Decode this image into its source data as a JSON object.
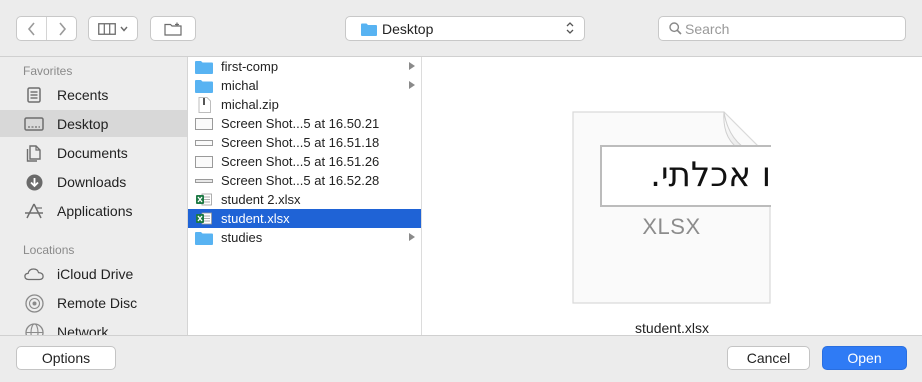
{
  "toolbar": {
    "location": "Desktop",
    "search_placeholder": "Search"
  },
  "sidebar": {
    "favorites_title": "Favorites",
    "favorites": [
      {
        "label": "Recents",
        "icon": "recents-icon"
      },
      {
        "label": "Desktop",
        "icon": "desktop-icon",
        "selected": true
      },
      {
        "label": "Documents",
        "icon": "documents-icon"
      },
      {
        "label": "Downloads",
        "icon": "downloads-icon"
      },
      {
        "label": "Applications",
        "icon": "applications-icon"
      }
    ],
    "locations_title": "Locations",
    "locations": [
      {
        "label": "iCloud Drive",
        "icon": "icloud-icon"
      },
      {
        "label": "Remote Disc",
        "icon": "disc-icon"
      },
      {
        "label": "Network",
        "icon": "network-icon"
      }
    ]
  },
  "files": [
    {
      "name": "first-comp",
      "type": "folder",
      "has_children": true
    },
    {
      "name": "michal",
      "type": "folder",
      "has_children": true
    },
    {
      "name": "michal.zip",
      "type": "zip"
    },
    {
      "name": "Screen Shot...5 at 16.50.21",
      "type": "screenshot"
    },
    {
      "name": "Screen Shot...5 at 16.51.18",
      "type": "screenshot"
    },
    {
      "name": "Screen Shot...5 at 16.51.26",
      "type": "screenshot"
    },
    {
      "name": "Screen Shot...5 at 16.52.28",
      "type": "screenshot"
    },
    {
      "name": "student 2.xlsx",
      "type": "xlsx"
    },
    {
      "name": "student.xlsx",
      "type": "xlsx",
      "selected": true
    },
    {
      "name": "studies",
      "type": "folder",
      "has_children": true
    }
  ],
  "preview": {
    "doc_text": "ו אכלתי.",
    "extension": "XLSX",
    "file_name": "student.xlsx"
  },
  "buttons": {
    "options": "Options",
    "cancel": "Cancel",
    "open": "Open"
  },
  "colors": {
    "accent": "#1f63d6",
    "primary_button": "#2f7bf5",
    "folder": "#58b3f2",
    "excel_green": "#1e7a45"
  }
}
